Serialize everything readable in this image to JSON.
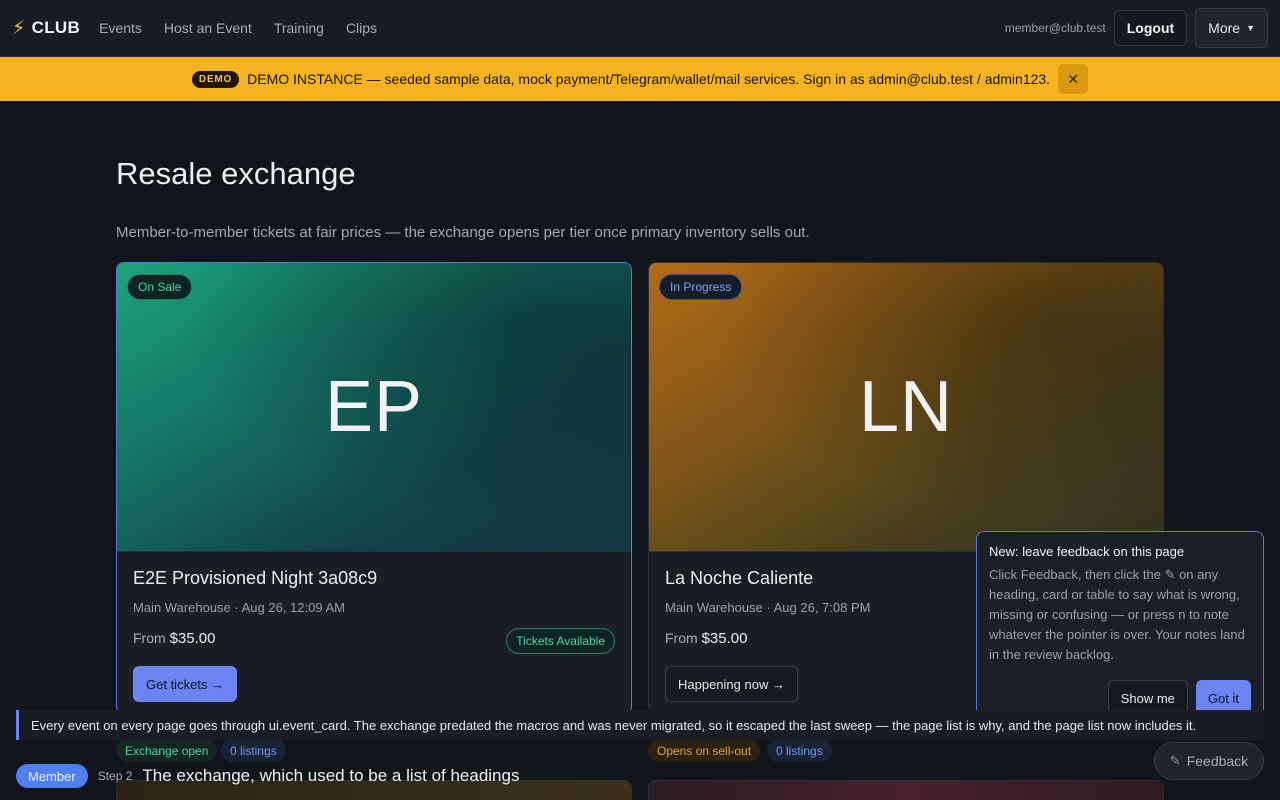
{
  "nav": {
    "brand": "CLUB",
    "links": [
      "Events",
      "Host an Event",
      "Training",
      "Clips"
    ],
    "email": "member@club.test",
    "logout": "Logout",
    "more": "More"
  },
  "demo": {
    "badge": "DEMO",
    "text": "DEMO INSTANCE — seeded sample data, mock payment/Telegram/wallet/mail services. Sign in as admin@club.test / admin123.",
    "close": "✕"
  },
  "page": {
    "title": "Resale exchange",
    "subtitle": "Member-to-member tickets at fair prices — the exchange opens per tier once primary inventory sells out."
  },
  "cards": [
    {
      "initials": "EP",
      "status": "On Sale",
      "title": "E2E Provisioned Night 3a08c9",
      "meta": "Main Warehouse · Aug 26, 12:09 AM",
      "price_label": "From",
      "price": "$35.00",
      "availability": "Tickets Available",
      "action": "Get tickets →",
      "tags": [
        "Exchange open",
        "0 listings"
      ]
    },
    {
      "initials": "LN",
      "status": "In Progress",
      "title": "La Noche Caliente",
      "meta": "Main Warehouse · Aug 26, 7:08 PM",
      "price_label": "From",
      "price": "$35.00",
      "action": "Happening now →",
      "tags": [
        "Opens on sell-out",
        "0 listings"
      ]
    }
  ],
  "tip": {
    "title": "New: leave feedback on this page",
    "text": "Click Feedback, then click the ✎ on any heading, card or table to say what is wrong, missing or confusing — or press n to note whatever the pointer is over. Your notes land in the review backlog.",
    "show": "Show me",
    "got": "Got it"
  },
  "step_note": "Every event on every page goes through ui.event_card. The exchange predated the macros and was never migrated, so it escaped the last sweep — the page list is why, and the page list now includes it.",
  "bottom": {
    "role": "Member",
    "step": "Step 2",
    "caption": "The exchange, which used to be a list of headings"
  },
  "feedback": {
    "label": "Feedback",
    "icon": "pencil-icon"
  },
  "colors": {
    "accent": "#6a85f2",
    "banner": "#f5b41f",
    "success": "#4dd6a3"
  }
}
